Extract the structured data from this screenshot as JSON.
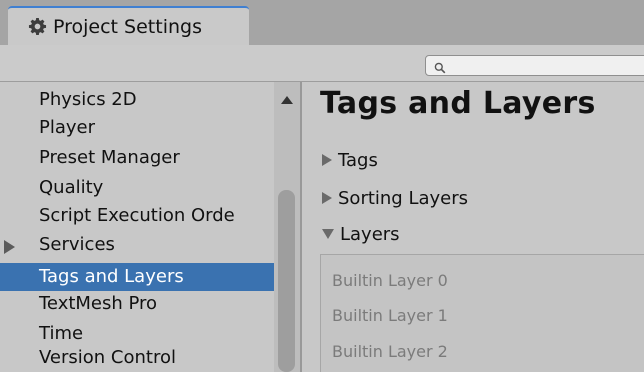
{
  "window": {
    "tab_title": "Project Settings",
    "tab_icon": "gear-icon"
  },
  "search": {
    "value": ""
  },
  "sidebar": {
    "items": [
      {
        "label": "Physics 2D"
      },
      {
        "label": "Player"
      },
      {
        "label": "Preset Manager"
      },
      {
        "label": "Quality"
      },
      {
        "label": "Script Execution Orde"
      },
      {
        "label": "Services",
        "expandable": true
      },
      {
        "label": "Tags and Layers",
        "selected": true
      },
      {
        "label": "TextMesh Pro"
      },
      {
        "label": "Time"
      },
      {
        "label": "Version Control"
      }
    ]
  },
  "main": {
    "title": "Tags and Layers",
    "sections": [
      {
        "label": "Tags",
        "expanded": false
      },
      {
        "label": "Sorting Layers",
        "expanded": false
      },
      {
        "label": "Layers",
        "expanded": true
      }
    ],
    "layers": [
      {
        "label": "Builtin Layer 0"
      },
      {
        "label": "Builtin Layer 1"
      },
      {
        "label": "Builtin Layer 2"
      }
    ]
  },
  "colors": {
    "selection": "#3a72b0",
    "tab_accent": "#3f7fd1"
  }
}
